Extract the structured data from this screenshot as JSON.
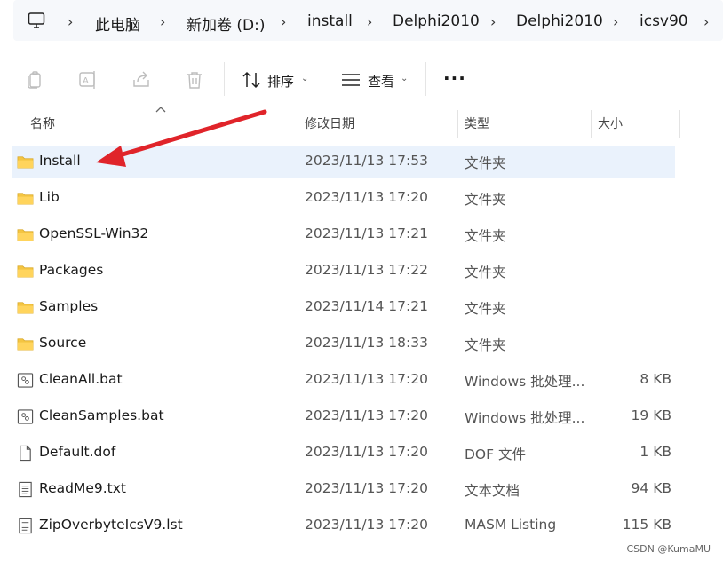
{
  "breadcrumb": {
    "items": [
      "此电脑",
      "新加卷 (D:)",
      "install",
      "Delphi2010",
      "Delphi2010",
      "icsv90"
    ]
  },
  "toolbar": {
    "copy_icon": "copy-icon",
    "rename_icon": "rename-icon",
    "share_icon": "share-icon",
    "delete_icon": "delete-icon",
    "sort_label": "排序",
    "view_label": "查看",
    "more_label": "···"
  },
  "columns": {
    "name": "名称",
    "modified": "修改日期",
    "type": "类型",
    "size": "大小"
  },
  "files": [
    {
      "name": "Install",
      "modified": "2023/11/13 17:53",
      "type": "文件夹",
      "size": "",
      "icon": "folder-icon",
      "selected": true
    },
    {
      "name": "Lib",
      "modified": "2023/11/13 17:20",
      "type": "文件夹",
      "size": "",
      "icon": "folder-icon"
    },
    {
      "name": "OpenSSL-Win32",
      "modified": "2023/11/13 17:21",
      "type": "文件夹",
      "size": "",
      "icon": "folder-icon"
    },
    {
      "name": "Packages",
      "modified": "2023/11/13 17:22",
      "type": "文件夹",
      "size": "",
      "icon": "folder-icon"
    },
    {
      "name": "Samples",
      "modified": "2023/11/14 17:21",
      "type": "文件夹",
      "size": "",
      "icon": "folder-icon"
    },
    {
      "name": "Source",
      "modified": "2023/11/13 18:33",
      "type": "文件夹",
      "size": "",
      "icon": "folder-icon"
    },
    {
      "name": "CleanAll.bat",
      "modified": "2023/11/13 17:20",
      "type": "Windows 批处理...",
      "size": "8 KB",
      "icon": "batch-file-icon"
    },
    {
      "name": "CleanSamples.bat",
      "modified": "2023/11/13 17:20",
      "type": "Windows 批处理...",
      "size": "19 KB",
      "icon": "batch-file-icon"
    },
    {
      "name": "Default.dof",
      "modified": "2023/11/13 17:20",
      "type": "DOF 文件",
      "size": "1 KB",
      "icon": "file-icon"
    },
    {
      "name": "ReadMe9.txt",
      "modified": "2023/11/13 17:20",
      "type": "文本文档",
      "size": "94 KB",
      "icon": "text-file-icon"
    },
    {
      "name": "ZipOverbyteIcsV9.lst",
      "modified": "2023/11/13 17:20",
      "type": "MASM Listing",
      "size": "115 KB",
      "icon": "text-file-icon"
    }
  ],
  "annotation": {
    "color": "#e0242a"
  },
  "watermark": "CSDN @KumaMU",
  "colors": {
    "selected_row": "#eaf2fc",
    "folder": "#f4c542",
    "breadcrumb_bg": "#f6f8fb"
  }
}
